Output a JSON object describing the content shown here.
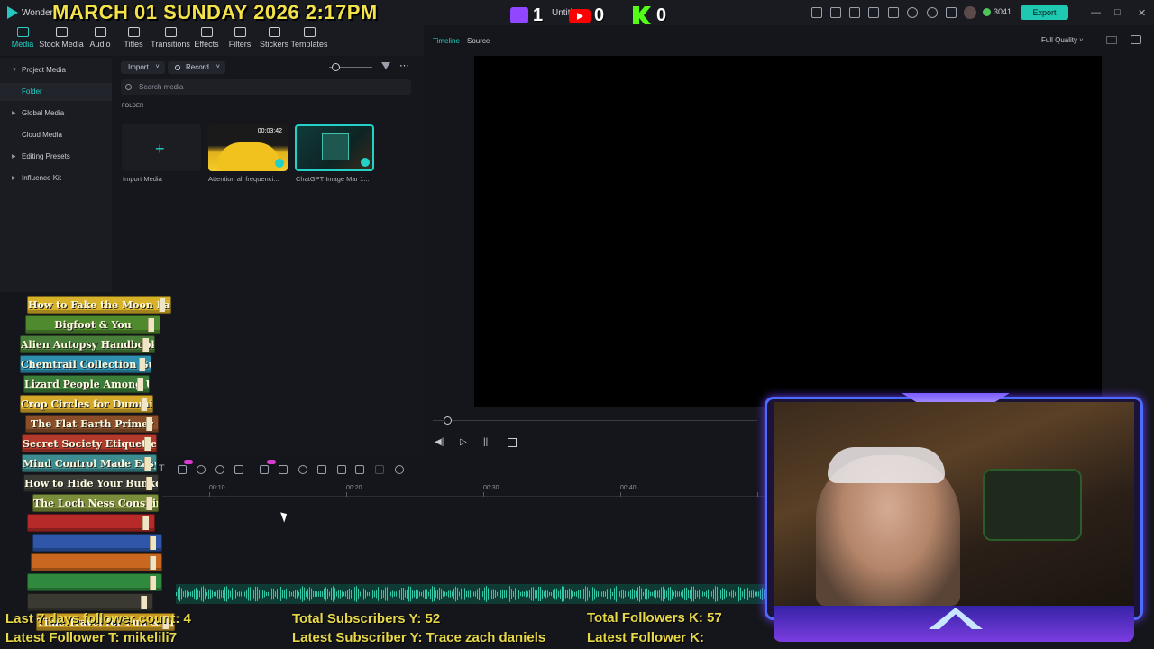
{
  "app": {
    "name": "Wondersh",
    "project_title": "Untitl",
    "date_overlay": "MARCH 01 SUNDAY 2026 2:17PM"
  },
  "stream": {
    "twitch_count": "1",
    "youtube_count": "0",
    "kick_count": "0"
  },
  "titlebar": {
    "credits": "3041",
    "export_label": "Export"
  },
  "toolbar": {
    "tools": [
      "Media",
      "Stock Media",
      "Audio",
      "Titles",
      "Transitions",
      "Effects",
      "Filters",
      "Stickers",
      "Templates"
    ]
  },
  "sidebar": {
    "items": [
      "Project Media",
      "Folder",
      "Global Media",
      "Cloud Media",
      "Editing Presets",
      "Influence Kit"
    ]
  },
  "media": {
    "import_label": "Import",
    "record_label": "Record",
    "search_placeholder": "Search media",
    "folder_label": "FOLDER",
    "items": [
      {
        "caption": "Import Media",
        "duration": ""
      },
      {
        "caption": "Attention all frequenci...",
        "duration": "00:03:42"
      },
      {
        "caption": "ChatGPT Image Mar 1...",
        "duration": ""
      }
    ]
  },
  "preview": {
    "tab_timeline": "Timeline",
    "tab_source": "Source",
    "quality": "Full Quality"
  },
  "timeline": {
    "ticks": [
      "00:10",
      "00:20",
      "00:30",
      "00:40"
    ]
  },
  "books": [
    {
      "title": "How to Fake the Moon Landing",
      "color": "#d8b12a"
    },
    {
      "title": "Bigfoot & You",
      "color": "#4f8a2f"
    },
    {
      "title": "Alien Autopsy Handbook",
      "color": "#4a7f3b"
    },
    {
      "title": "Chemtrail Collection Guide",
      "color": "#2f8fae"
    },
    {
      "title": "Lizard People Among Us",
      "color": "#3d7d3a"
    },
    {
      "title": "Crop Circles for Dummies",
      "color": "#d4a92a"
    },
    {
      "title": "The Flat Earth Primer",
      "color": "#8a4f2a"
    },
    {
      "title": "Secret Society Etiquette",
      "color": "#b2392b"
    },
    {
      "title": "Mind Control Made Easy",
      "color": "#3d8c8f"
    },
    {
      "title": "How to Hide Your Bunker",
      "color": "#3a3a36"
    },
    {
      "title": "The Loch Ness Conspiracy",
      "color": "#7a8d3a"
    },
    {
      "title": "",
      "color": "#b62a2a"
    },
    {
      "title": "",
      "color": "#2f56a8"
    },
    {
      "title": "",
      "color": "#c9661f"
    },
    {
      "title": "",
      "color": "#2f8a3e"
    },
    {
      "title": "",
      "color": "#3a3a32"
    },
    {
      "title": "Time Travel for Fun & Profit",
      "color": "#c89a22"
    }
  ],
  "stats": {
    "followers_7_days": "Last 7 days follower count: 4",
    "latest_follower_t": "Latest Follower T: mikelili7",
    "total_subscribers_y": "Total Subscribers Y: 52",
    "latest_subscriber_y": "Latest Subscriber Y: Trace zach daniels",
    "total_followers_k": "Total Followers K: 57",
    "latest_follower_k": "Latest Follower K:"
  },
  "colors": {
    "accent": "#23d1c6",
    "export": "#1fc8b0",
    "stat_yellow": "#e7d84a",
    "twitch": "#9146ff",
    "youtube": "#ff0000",
    "kick": "#53fc18"
  }
}
